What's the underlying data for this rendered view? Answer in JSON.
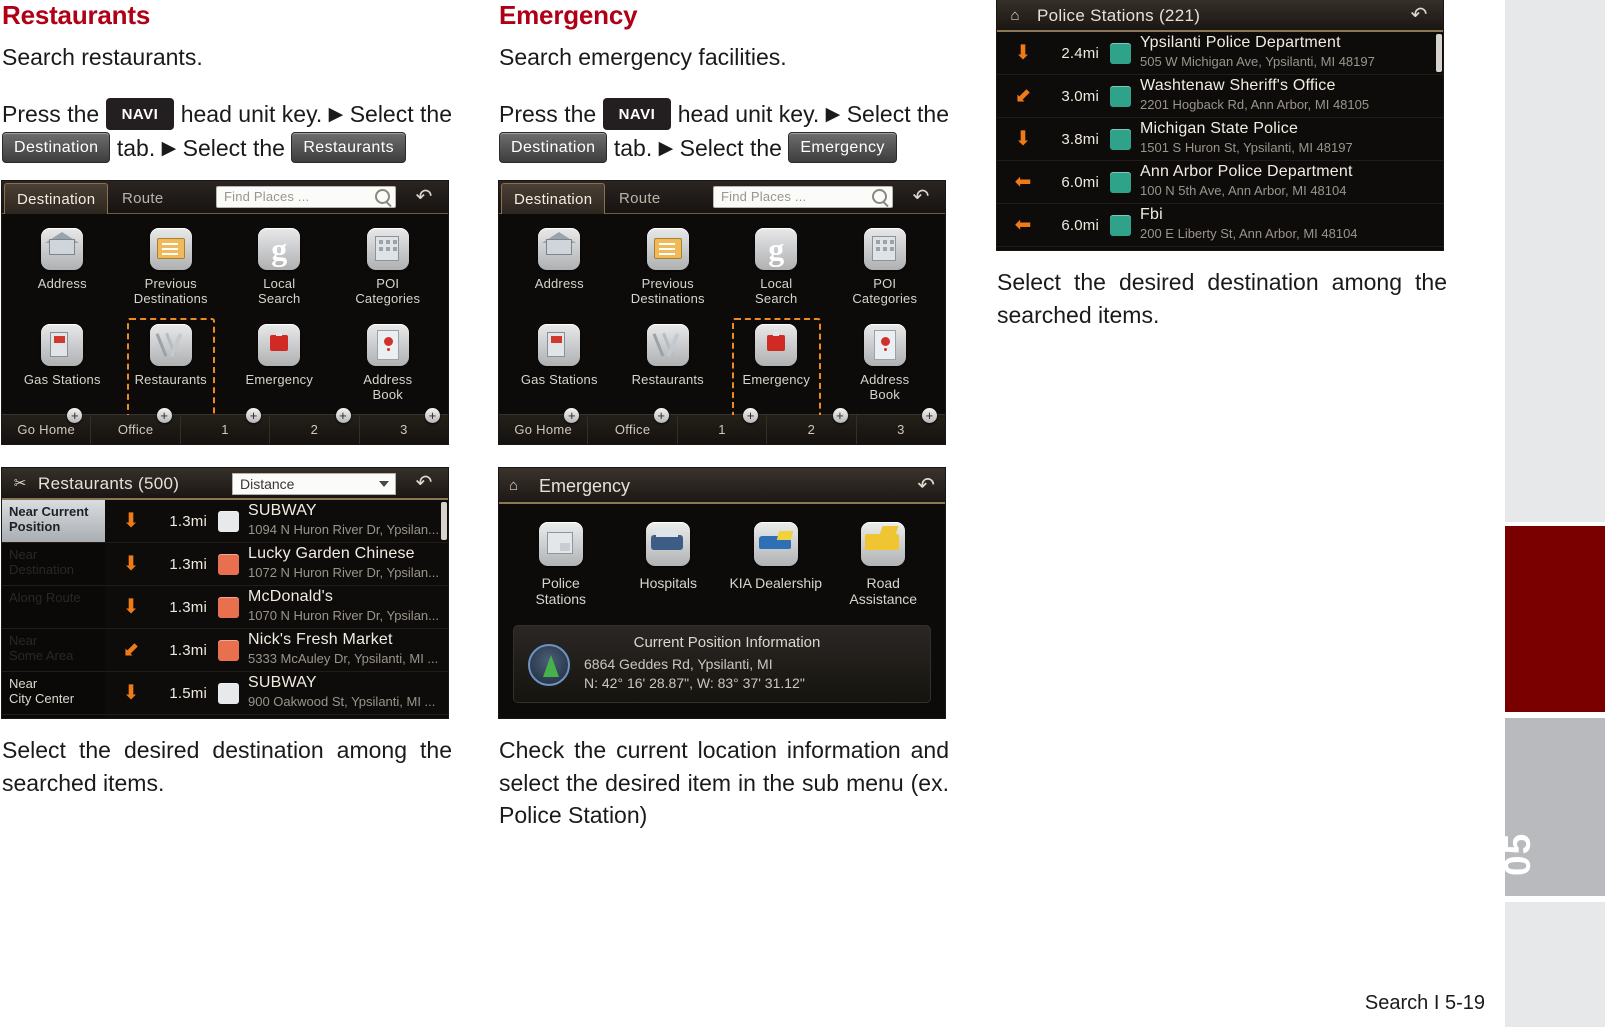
{
  "page": {
    "footer": "Search I 5-19",
    "edge_tab_number": "05",
    "accent_red": "#b00017",
    "tab_red": "#7a0000",
    "tab_grey": "#b8babd",
    "highlight_orange": "#f08a1e"
  },
  "restaurants_section": {
    "title": "Restaurants",
    "intro": "Search restaurants.",
    "instruction": {
      "part1": "Press the",
      "key": "NAVI",
      "part2": "head unit key.",
      "arrow": "▶",
      "part3": "Select the",
      "tab_chip": "Destination",
      "part4": "tab.",
      "part5": "Select the",
      "target_chip": "Restaurants"
    },
    "caption": "Select the desired destination among the searched items."
  },
  "emergency_section": {
    "title": "Emergency",
    "intro": "Search emergency facilities.",
    "instruction": {
      "part1": "Press the",
      "key": "NAVI",
      "part2": "head unit key.",
      "arrow": "▶",
      "part3": "Select the",
      "tab_chip": "Destination",
      "part4": "tab.",
      "part5": "Select the",
      "target_chip": "Emergency"
    },
    "caption": "Check the current location information and select the desired item in the sub menu (ex. Police Station)"
  },
  "police_section": {
    "caption": "Select the desired destination among the searched items."
  },
  "nav_screen": {
    "tab_destination": "Destination",
    "tab_route": "Route",
    "search_placeholder": "Find Places ...",
    "back_icon": "↶",
    "search_icon": "search-icon",
    "tiles": [
      {
        "label": "Address",
        "art": "house"
      },
      {
        "label": "Previous\nDestinations",
        "art": "folder"
      },
      {
        "label": "Local\nSearch",
        "art": "google"
      },
      {
        "label": "POI\nCategories",
        "art": "building"
      },
      {
        "label": "Gas Stations",
        "art": "pump"
      },
      {
        "label": "Restaurants",
        "art": "cutlery"
      },
      {
        "label": "Emergency",
        "art": "sos"
      },
      {
        "label": "Address\nBook",
        "art": "pin"
      }
    ],
    "quickbar": [
      {
        "label": "Go Home",
        "plus": "+"
      },
      {
        "label": "Office",
        "plus": "+"
      },
      {
        "label": "1",
        "plus": "+"
      },
      {
        "label": "2",
        "plus": "+"
      },
      {
        "label": "3",
        "plus": "+"
      }
    ],
    "selected_restaurants": "Restaurants",
    "selected_emergency": "Emergency"
  },
  "restaurant_list": {
    "icon": "cutlery-icon",
    "title": "Restaurants (500)",
    "sort_value": "Distance",
    "back_icon": "↶",
    "side_items": [
      {
        "label": "Near Current\nPosition",
        "state": "active"
      },
      {
        "label": "Near\nDestination",
        "state": "dim"
      },
      {
        "label": "Along Route",
        "state": "dim"
      },
      {
        "label": "Near\nSome Area",
        "state": "dim"
      },
      {
        "label": "Near\nCity Center",
        "state": "bright"
      }
    ],
    "rows": [
      {
        "arrow": "⬇",
        "distance": "1.3mi",
        "badge": "white",
        "name": "SUBWAY",
        "address": "1094 N Huron River Dr, Ypsilan..."
      },
      {
        "arrow": "⬇",
        "distance": "1.3mi",
        "badge": "orange",
        "name": "Lucky Garden Chinese",
        "address": "1072 N Huron River Dr, Ypsilan..."
      },
      {
        "arrow": "⬇",
        "distance": "1.3mi",
        "badge": "orange",
        "name": "McDonald's",
        "address": "1070 N Huron River Dr, Ypsilan..."
      },
      {
        "arrow": "⬋",
        "distance": "1.3mi",
        "badge": "orange",
        "name": "Nick's Fresh Market",
        "address": "5333 McAuley Dr, Ypsilanti, MI ..."
      },
      {
        "arrow": "⬇",
        "distance": "1.5mi",
        "badge": "white",
        "name": "SUBWAY",
        "address": "900 Oakwood St, Ypsilanti, MI ..."
      }
    ]
  },
  "emergency_menu": {
    "icon": "home-icon",
    "title": "Emergency",
    "back_icon": "↶",
    "tiles": [
      {
        "label": "Police\nStations",
        "art": "police"
      },
      {
        "label": "Hospitals",
        "art": "hospital"
      },
      {
        "label": "KIA Dealership",
        "art": "kia"
      },
      {
        "label": "Road\nAssistance",
        "art": "tow"
      }
    ],
    "current_position": {
      "heading": "Current Position Information",
      "address": "6864 Geddes Rd, Ypsilanti, MI",
      "coords": "N: 42° 16' 28.87\", W: 83° 37' 31.12\""
    }
  },
  "police_list": {
    "icon": "home-icon",
    "title": "Police Stations (221)",
    "back_icon": "↶",
    "rows": [
      {
        "arrow": "⬇",
        "distance": "2.4mi",
        "name": "Ypsilanti Police Department",
        "address": "505 W Michigan Ave, Ypsilanti, MI 48197"
      },
      {
        "arrow": "⬋",
        "distance": "3.0mi",
        "name": "Washtenaw Sheriff's Office",
        "address": "2201 Hogback Rd, Ann Arbor, MI 48105"
      },
      {
        "arrow": "⬇",
        "distance": "3.8mi",
        "name": "Michigan State Police",
        "address": "1501 S Huron St, Ypsilanti, MI 48197"
      },
      {
        "arrow": "⬅",
        "distance": "6.0mi",
        "name": "Ann Arbor Police Department",
        "address": "100 N 5th Ave, Ann Arbor, MI 48104"
      },
      {
        "arrow": "⬅",
        "distance": "6.0mi",
        "name": "Fbi",
        "address": "200 E Liberty St, Ann Arbor, MI 48104"
      }
    ]
  }
}
